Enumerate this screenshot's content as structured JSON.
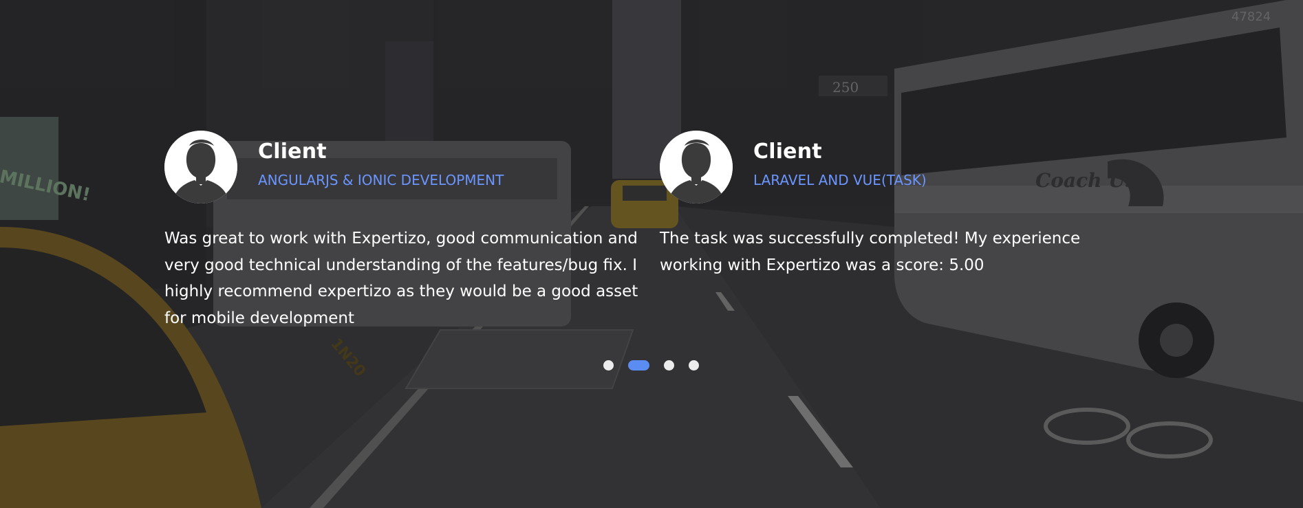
{
  "testimonials": [
    {
      "name": "Client",
      "project": "ANGULARJS & IONIC DEVELOPMENT",
      "quote": "Was great to work with Expertizo, good communication and very good technical understanding of the features/bug fix. I highly recommend expertizo as they would be a good asset for mobile development"
    },
    {
      "name": "Client",
      "project": "LARAVEL AND VUE(TASK)",
      "quote": "The task was successfully completed! My experience working with Expertizo was a score: 5.00"
    }
  ],
  "background": {
    "sign_250": "250",
    "bus_number": "47824",
    "bus_brand": "Coach USA",
    "billboard": "MILLION!",
    "taxi_number": "1N20"
  },
  "carousel": {
    "slide_count": 4,
    "active_index": 1
  },
  "colors": {
    "accent": "#5b8cf2",
    "role_text": "#6b95ff",
    "dot_inactive": "#ececec",
    "overlay": "#2a2a2c"
  }
}
